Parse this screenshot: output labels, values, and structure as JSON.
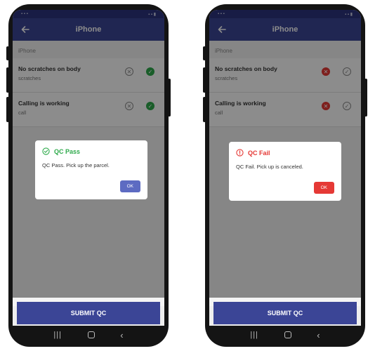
{
  "colors": {
    "appbar": "#3b4596",
    "pass_green": "#2eaa4b",
    "fail_red": "#e53935",
    "ok_button_pass": "#5d6bc2",
    "ok_button_fail": "#e53935"
  },
  "screens": [
    {
      "app_title": "iPhone",
      "section_label": "iPhone",
      "items": [
        {
          "title": "No scratches on body",
          "subtitle": "scratches",
          "reject_icon": "x-circle-outline-icon",
          "accept_icon": "check-circle-filled-icon"
        },
        {
          "title": "Calling is working",
          "subtitle": "call",
          "reject_icon": "x-circle-outline-icon",
          "accept_icon": "check-circle-filled-icon"
        }
      ],
      "submit_label": "SUBMIT QC",
      "dialog": {
        "icon": "check-circle-outline-icon",
        "title": "QC Pass",
        "message": "QC Pass. Pick up the parcel.",
        "button": "OK"
      }
    },
    {
      "app_title": "iPhone",
      "section_label": "iPhone",
      "items": [
        {
          "title": "No scratches on body",
          "subtitle": "scratches",
          "reject_icon": "x-circle-filled-icon",
          "accept_icon": "check-circle-outline-icon"
        },
        {
          "title": "Calling is working",
          "subtitle": "call",
          "reject_icon": "x-circle-filled-icon",
          "accept_icon": "check-circle-outline-icon"
        }
      ],
      "submit_label": "SUBMIT QC",
      "dialog": {
        "icon": "alert-circle-outline-icon",
        "title": "QC Fail",
        "message": "QC Fail. Pick up is canceled.",
        "button": "OK"
      }
    }
  ]
}
